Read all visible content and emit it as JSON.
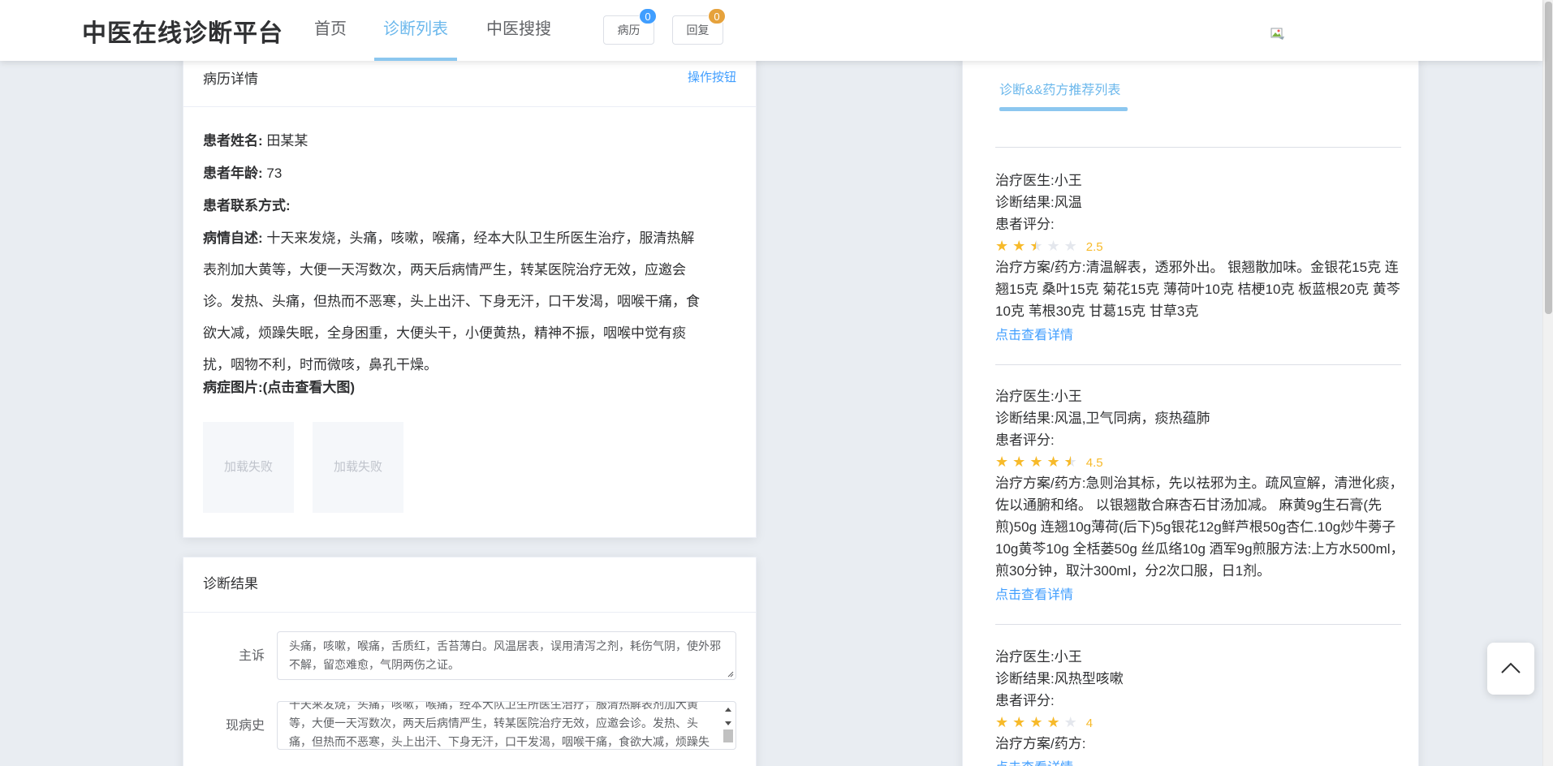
{
  "header": {
    "brand": "中医在线诊断平台",
    "nav": [
      {
        "label": "首页"
      },
      {
        "label": "诊断列表"
      },
      {
        "label": "中医搜搜"
      }
    ],
    "buttons": [
      {
        "label": "病历",
        "badge": "0",
        "badge_color": "#409eff"
      },
      {
        "label": "回复",
        "badge": "0",
        "badge_color": "#e6a23c"
      }
    ]
  },
  "record": {
    "title": "病历详情",
    "op_link": "操作按钮",
    "name_label": "患者姓名:",
    "name": "田某某",
    "age_label": "患者年龄:",
    "age": "73",
    "contact_label": "患者联系方式:",
    "contact": "",
    "desc_label": "病情自述:",
    "desc_lines": [
      "十天来发烧，头痛，咳嗽，喉痛，经本大队卫生所医生治疗，服清热解",
      "表剂加大黄等，大便一天泻数次，两天后病情严生，转某医院治疗无效，应邀会",
      "诊。发热、头痛，但热而不恶寒，头上出汗、下身无汗，口干发渴，咽喉干痛，食",
      "欲大减，烦躁失眠，全身困重，大便头干，小便黄热，精神不振，咽喉中觉有痰",
      "扰，咽物不利，时而微咳，鼻孔干燥。"
    ],
    "images_label": "病症图片:(点击查看大图)",
    "images": [
      "加载失败",
      "加载失败"
    ]
  },
  "result": {
    "title": "诊断结果",
    "complaint_label": "主诉",
    "complaint": "头痛，咳嗽，喉痛，舌质红，舌苔薄白。风温居表，误用清泻之剂，耗伤气阴，使外邪不解，留恋难愈，气阴两伤之证。",
    "history_label": "现病史",
    "history": "十天来发烧，头痛，咳嗽，喉痛，经本大队卫生所医生治疗，服清热解表剂加大黄等，大便一天泻数次，两天后病情严生，转某医院治疗无效，应邀会诊。发热、头痛，但热而不恶寒，头上出汗、下身无汗，口干发渴，咽喉干痛，食欲大减，烦躁失眠，全身困重，大便头干，小便黄热，精神不振"
  },
  "recommend": {
    "tab_label": "诊断&&药方推荐列表",
    "items": [
      {
        "doctor": "治疗医生:小王",
        "diagnosis": "诊断结果:风温",
        "rating_label": "患者评分:",
        "rating": 2.5,
        "rating_text": "2.5",
        "plan": "治疗方案/药方:清温解表，透邪外出。 银翘散加味。金银花15克 连翘15克 桑叶15克 菊花15克 薄荷叶10克 桔梗10克 板蓝根20克 黄芩10克 苇根30克 甘葛15克 甘草3克",
        "link": "点击查看详情"
      },
      {
        "doctor": "治疗医生:小王",
        "diagnosis": "诊断结果:风温,卫气同病，痰热蕴肺",
        "rating_label": "患者评分:",
        "rating": 4.5,
        "rating_text": "4.5",
        "plan": "治疗方案/药方:急则治其标，先以祛邪为主。疏风宣解，清泄化痰，佐以通腑和络。 以银翘散合麻杏石甘汤加减。 麻黄9g生石膏(先煎)50g 连翘10g薄荷(后下)5g银花12g鲜芦根50g杏仁.10g炒牛蒡子10g黄芩10g 全栝蒌50g 丝瓜络10g 酒军9g煎服方法:上方水500ml，煎30分钟，取汁300ml，分2次口服，日1剂。",
        "link": "点击查看详情"
      },
      {
        "doctor": "治疗医生:小王",
        "diagnosis": "诊断结果:风热型咳嗽",
        "rating_label": "患者评分:",
        "rating": 4,
        "rating_text": "4",
        "plan": "治疗方案/药方:",
        "link": "点击查看详情"
      }
    ]
  }
}
